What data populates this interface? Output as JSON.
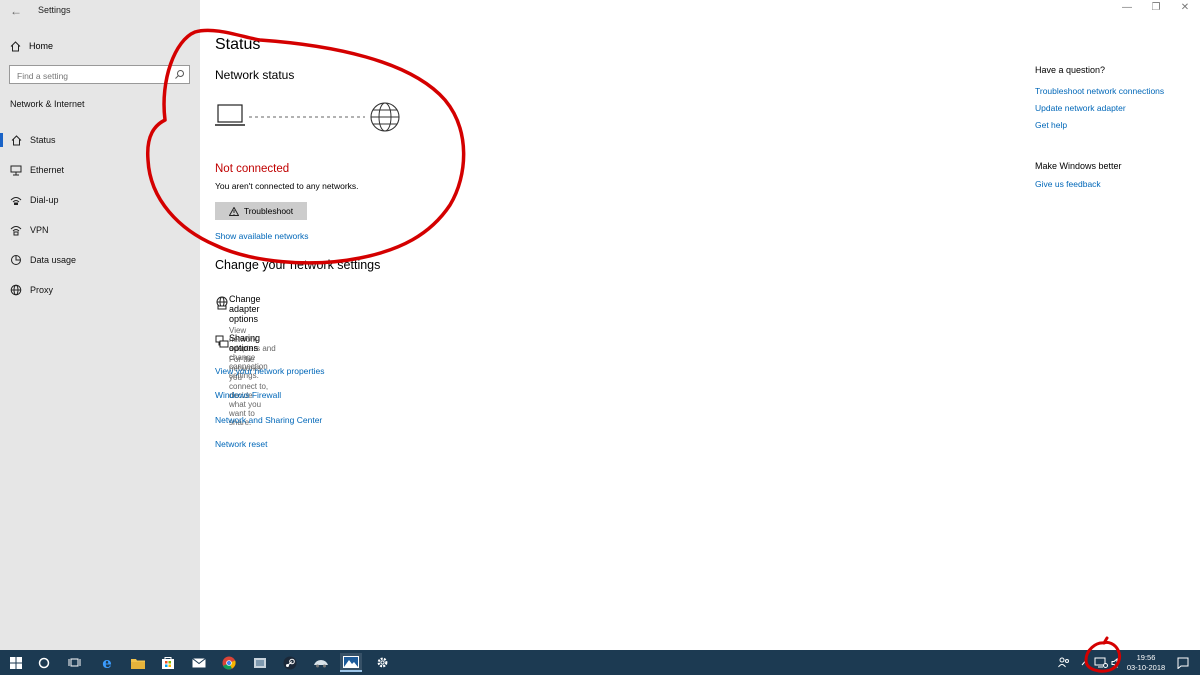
{
  "window": {
    "title": "Settings",
    "controls": {
      "minimize": "—",
      "maximize": "❐",
      "close": "✕"
    }
  },
  "sidebar": {
    "home_label": "Home",
    "search_placeholder": "Find a setting",
    "section_title": "Network & Internet",
    "items": [
      {
        "label": "Status",
        "icon": "home-status-icon",
        "selected": true
      },
      {
        "label": "Ethernet",
        "icon": "ethernet-icon",
        "selected": false
      },
      {
        "label": "Dial-up",
        "icon": "dialup-icon",
        "selected": false
      },
      {
        "label": "VPN",
        "icon": "vpn-icon",
        "selected": false
      },
      {
        "label": "Data usage",
        "icon": "data-usage-icon",
        "selected": false
      },
      {
        "label": "Proxy",
        "icon": "globe-icon",
        "selected": false
      }
    ]
  },
  "main": {
    "title": "Status",
    "network_status_heading": "Network status",
    "connection_state": "Not connected",
    "connection_desc": "You aren't connected to any networks.",
    "troubleshoot_label": "Troubleshoot",
    "show_networks_link": "Show available networks",
    "change_settings_heading": "Change your network settings",
    "options": [
      {
        "title": "Change adapter options",
        "desc": "View network adapters and change connection settings.",
        "icon": "adapter-icon"
      },
      {
        "title": "Sharing options",
        "desc": "For the networks you connect to, decide what you want to share.",
        "icon": "sharing-icon"
      }
    ],
    "links": [
      "View your network properties",
      "Windows Firewall",
      "Network and Sharing Center",
      "Network reset"
    ]
  },
  "right_panel": {
    "question_heading": "Have a question?",
    "question_links": [
      "Troubleshoot network connections",
      "Update network adapter",
      "Get help"
    ],
    "better_heading": "Make Windows better",
    "feedback_link": "Give us feedback"
  },
  "taskbar": {
    "time": "19:56",
    "date": "03-10-2018",
    "apps": [
      "start-icon",
      "cortana-icon",
      "task-view-icon",
      "edge-icon",
      "file-explorer-icon",
      "store-icon",
      "mail-icon",
      "chrome-icon",
      "app-icon",
      "steam-icon",
      "car-app-icon",
      "photos-icon",
      "settings-icon"
    ]
  },
  "colors": {
    "sidebar_bg": "#e6e6e6",
    "accent": "#0067b8",
    "error": "#c00000",
    "taskbar_bg": "#1c3a52",
    "annotation": "#d40000"
  }
}
